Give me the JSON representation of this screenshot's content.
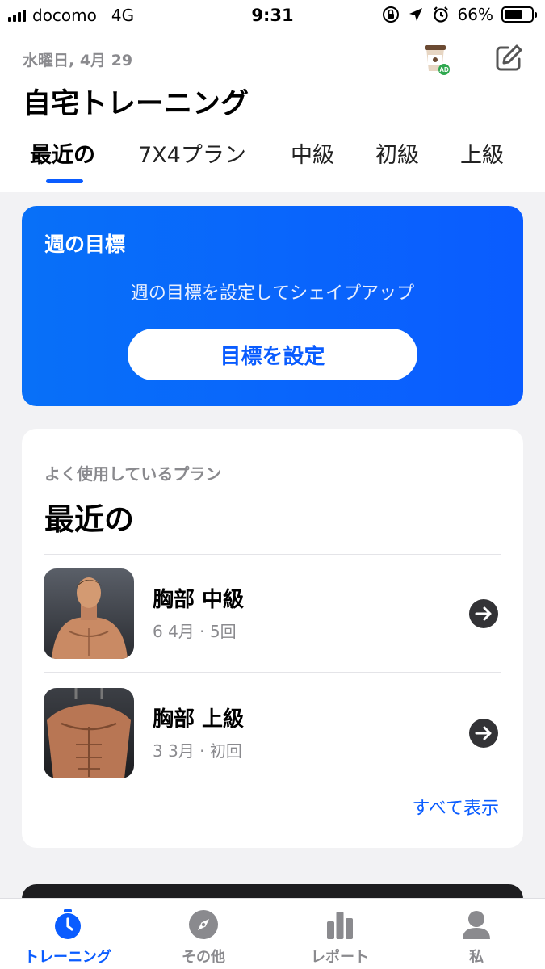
{
  "status_bar": {
    "carrier": "docomo",
    "network": "4G",
    "time": "9:31",
    "battery_percent": "66%",
    "battery_level": 0.66
  },
  "header": {
    "date": "水曜日, 4月 29",
    "title": "自宅トレーニング",
    "ad_badge": "AD"
  },
  "tabs": [
    {
      "label": "最近の",
      "active": true
    },
    {
      "label": "7X4プラン",
      "active": false
    },
    {
      "label": "中級",
      "active": false
    },
    {
      "label": "初級",
      "active": false
    },
    {
      "label": "上級",
      "active": false
    }
  ],
  "goal_card": {
    "title": "週の目標",
    "description": "週の目標を設定してシェイプアップ",
    "button_label": "目標を設定"
  },
  "recent_card": {
    "subtitle": "よく使用しているプラン",
    "title": "最近の",
    "plans": [
      {
        "name": "胸部 中級",
        "meta": "6 4月 · 5回"
      },
      {
        "name": "胸部 上級",
        "meta": "3 3月 · 初回"
      }
    ],
    "view_all": "すべて表示"
  },
  "bottom_nav": [
    {
      "label": "トレーニング",
      "icon": "timer-icon",
      "active": true
    },
    {
      "label": "その他",
      "icon": "compass-icon",
      "active": false
    },
    {
      "label": "レポート",
      "icon": "bar-chart-icon",
      "active": false
    },
    {
      "label": "私",
      "icon": "profile-icon",
      "active": false
    }
  ],
  "colors": {
    "accent": "#0a5cff",
    "goal_gradient_start": "#0870f8",
    "secondary_text": "#8a8a8e"
  }
}
